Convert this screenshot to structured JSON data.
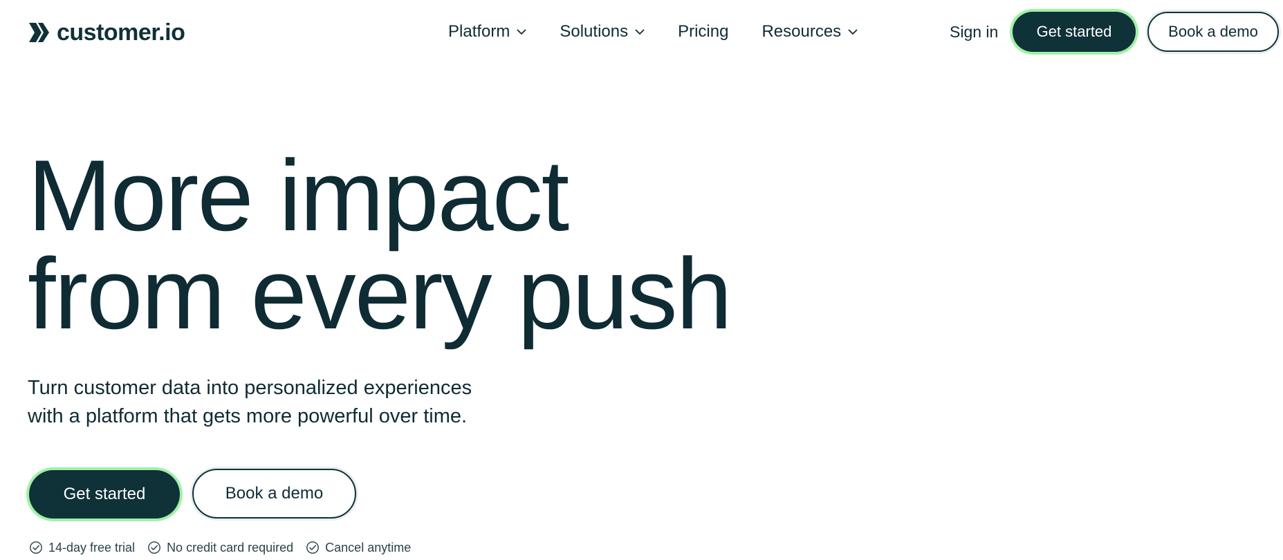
{
  "brand": {
    "name": "customer.io",
    "logo_icon": "double-chevron-logo-icon",
    "color": "#0f3138",
    "accent": "#9ff2a6"
  },
  "nav": {
    "items": [
      {
        "label": "Platform",
        "has_dropdown": true
      },
      {
        "label": "Solutions",
        "has_dropdown": true
      },
      {
        "label": "Pricing",
        "has_dropdown": false
      },
      {
        "label": "Resources",
        "has_dropdown": true
      }
    ],
    "sign_in": "Sign in",
    "get_started": "Get started",
    "book_demo": "Book a demo"
  },
  "hero": {
    "title_line1": "More impact",
    "title_line2": "from every push",
    "subtitle_line1": "Turn customer data into personalized experiences",
    "subtitle_line2": "with a platform that gets more powerful over time.",
    "primary_cta": "Get started",
    "secondary_cta": "Book a demo",
    "perks": [
      {
        "label": "14-day free trial",
        "icon": "check-circle-icon"
      },
      {
        "label": "No credit card required",
        "icon": "check-circle-icon"
      },
      {
        "label": "Cancel anytime",
        "icon": "check-circle-icon"
      }
    ]
  }
}
